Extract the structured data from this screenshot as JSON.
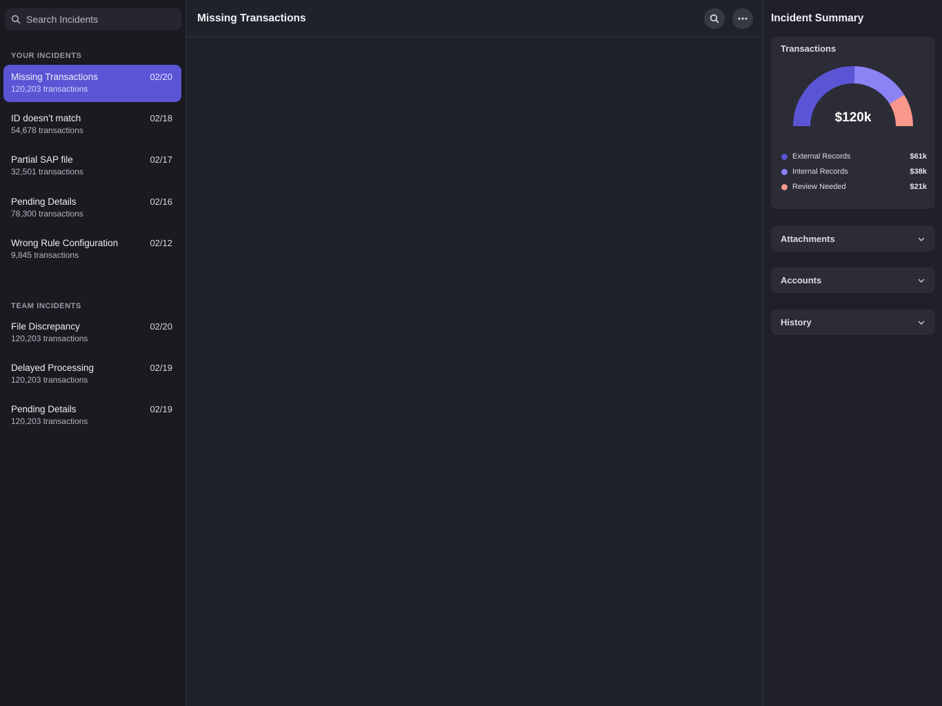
{
  "search": {
    "placeholder": "Search Incidents"
  },
  "sections": {
    "your_incidents": "YOUR INCIDENTS",
    "team_incidents": "TEAM INCIDENTS"
  },
  "your_incidents": [
    {
      "title": "Missing Transactions",
      "date": "02/20",
      "count": "120,203 transactions",
      "active": true
    },
    {
      "title": "ID doesn’t match",
      "date": "02/18",
      "count": "54,678 transactions"
    },
    {
      "title": "Partial SAP file",
      "date": "02/17",
      "count": "32,501 transactions"
    },
    {
      "title": "Pending Details",
      "date": "02/16",
      "count": "78,300 transactions"
    },
    {
      "title": "Wrong Rule Configuration",
      "date": "02/12",
      "count": "9,845 transactions"
    }
  ],
  "team_incidents": [
    {
      "title": "File Discrepancy",
      "date": "02/20",
      "count": "120,203 transactions"
    },
    {
      "title": "Delayed Processing",
      "date": "02/19",
      "count": "120,203 transactions"
    },
    {
      "title": "Pending Details",
      "date": "02/19",
      "count": "120,203 transactions"
    }
  ],
  "main": {
    "title": "Missing Transactions",
    "icons": [
      "search-icon",
      "more-icon"
    ]
  },
  "summary": {
    "title": "Incident Summary",
    "card_title": "Transactions",
    "total": "$120k",
    "legend": [
      {
        "label": "External Records",
        "value": "$61k",
        "color": "#5b55d6"
      },
      {
        "label": "Internal Records",
        "value": "$38k",
        "color": "#8b82f5"
      },
      {
        "label": "Review Needed",
        "value": "$21k",
        "color": "#f8978a"
      }
    ],
    "accordions": [
      "Attachments",
      "Accounts",
      "History"
    ]
  },
  "chart_data": {
    "type": "pie",
    "title": "Transactions",
    "categories": [
      "External Records",
      "Internal Records",
      "Review Needed"
    ],
    "values": [
      61,
      38,
      21
    ],
    "center_label": "$120k",
    "style": "semi-donut",
    "legend_position": "bottom"
  }
}
